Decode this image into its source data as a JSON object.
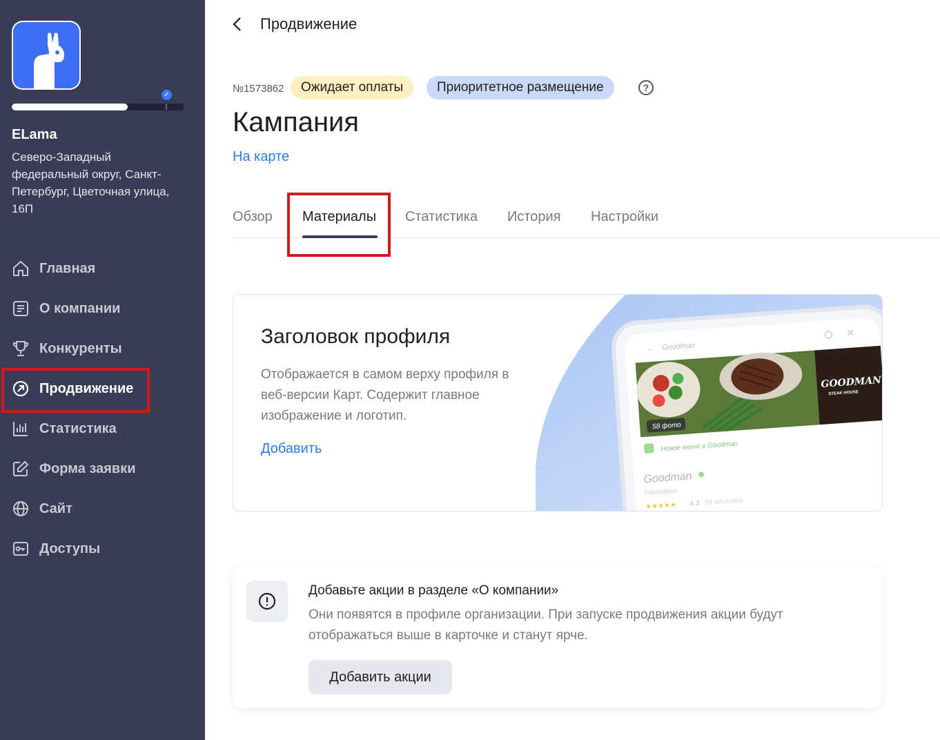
{
  "sidebar": {
    "org_name": "ELama",
    "org_address": "Северо-Западный федеральный округ, Санкт-Петербург, Цветочная улица, 16П",
    "progress_fraction": 0.67,
    "nav": [
      {
        "label": "Главная",
        "icon": "home-icon"
      },
      {
        "label": "О компании",
        "icon": "document-icon"
      },
      {
        "label": "Конкуренты",
        "icon": "trophy-icon"
      },
      {
        "label": "Продвижение",
        "icon": "promotion-icon",
        "active": true
      },
      {
        "label": "Статистика",
        "icon": "bar-chart-icon"
      },
      {
        "label": "Форма заявки",
        "icon": "edit-form-icon"
      },
      {
        "label": "Сайт",
        "icon": "globe-icon"
      },
      {
        "label": "Доступы",
        "icon": "key-icon"
      }
    ]
  },
  "header": {
    "breadcrumb": "Продвижение",
    "order_number": "№1573862",
    "status_badge": "Ожидает оплаты",
    "type_badge": "Приоритетное размещение",
    "title": "Кампания",
    "map_link": "На карте"
  },
  "tabs": [
    {
      "label": "Обзор"
    },
    {
      "label": "Материалы",
      "active": true
    },
    {
      "label": "Статистика"
    },
    {
      "label": "История"
    },
    {
      "label": "Настройки"
    }
  ],
  "profile_card": {
    "title": "Заголовок профиля",
    "description": "Отображается в самом верху профиля в веб-версии Карт. Содержит главное изображение и логотип.",
    "action": "Добавить",
    "preview": {
      "search_text": "Goodman",
      "photo_count": "58 фото",
      "brand": "GOODMAN",
      "brand_sub": "STEAK HOUSE",
      "menu_banner": "Новое меню в Goodman",
      "name": "Goodman",
      "category": "Ресторан",
      "rating": "4.3",
      "reviews": "58 отзывов"
    }
  },
  "promo_card": {
    "title": "Добавьте акции в разделе «О компании»",
    "description": "Они появятся в профиле организации. При запуске продвижения акции будут отображаться выше в карточке и станут ярче.",
    "button": "Добавить акции"
  },
  "colors": {
    "sidebar_bg": "#3a3b55",
    "accent_link": "#2b7be6",
    "highlight_red": "#d11b1b",
    "badge_yellow": "#fcefc2",
    "badge_blue": "#c9d9f7"
  }
}
